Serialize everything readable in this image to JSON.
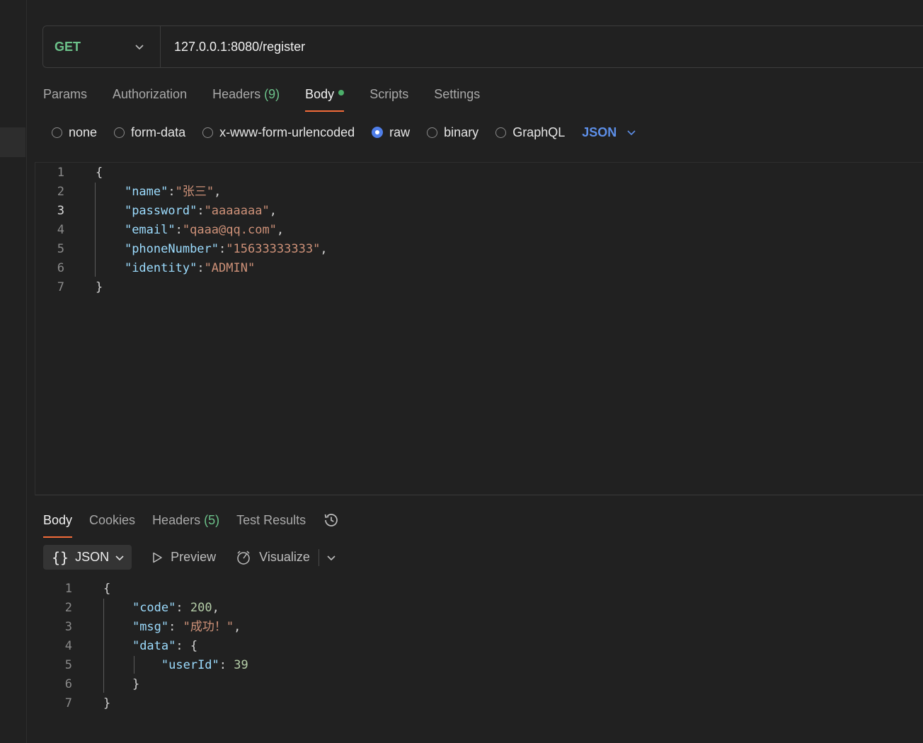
{
  "request": {
    "method": "GET",
    "url": "127.0.0.1:8080/register",
    "tabs": [
      {
        "label": "Params"
      },
      {
        "label": "Authorization"
      },
      {
        "label": "Headers",
        "count": "(9)"
      },
      {
        "label": "Body"
      },
      {
        "label": "Scripts"
      },
      {
        "label": "Settings"
      }
    ],
    "body_types": [
      "none",
      "form-data",
      "x-www-form-urlencoded",
      "raw",
      "binary",
      "GraphQL"
    ],
    "selected_body_type": "raw",
    "language": "JSON",
    "body_lines": [
      {
        "n": "1",
        "tokens": [
          [
            "p",
            "{"
          ]
        ]
      },
      {
        "n": "2",
        "tokens": [
          [
            "p",
            "    "
          ],
          [
            "k",
            "\"name\""
          ],
          [
            "p",
            ":"
          ],
          [
            "s",
            "\"张三\""
          ],
          [
            "p",
            ","
          ]
        ]
      },
      {
        "n": "3",
        "tokens": [
          [
            "p",
            "    "
          ],
          [
            "k",
            "\"password\""
          ],
          [
            "p",
            ":"
          ],
          [
            "s",
            "\"aaaaaaa\""
          ],
          [
            "p",
            ","
          ]
        ]
      },
      {
        "n": "4",
        "tokens": [
          [
            "p",
            "    "
          ],
          [
            "k",
            "\"email\""
          ],
          [
            "p",
            ":"
          ],
          [
            "s",
            "\"qaaa@qq.com\""
          ],
          [
            "p",
            ","
          ]
        ]
      },
      {
        "n": "5",
        "tokens": [
          [
            "p",
            "    "
          ],
          [
            "k",
            "\"phoneNumber\""
          ],
          [
            "p",
            ":"
          ],
          [
            "s",
            "\"15633333333\""
          ],
          [
            "p",
            ","
          ]
        ]
      },
      {
        "n": "6",
        "tokens": [
          [
            "p",
            "    "
          ],
          [
            "k",
            "\"identity\""
          ],
          [
            "p",
            ":"
          ],
          [
            "s",
            "\"ADMIN\""
          ]
        ]
      },
      {
        "n": "7",
        "tokens": [
          [
            "p",
            "}"
          ]
        ]
      }
    ]
  },
  "response": {
    "tabs": [
      {
        "label": "Body"
      },
      {
        "label": "Cookies"
      },
      {
        "label": "Headers",
        "count": "(5)"
      },
      {
        "label": "Test Results"
      }
    ],
    "format_label": "JSON",
    "preview_label": "Preview",
    "visualize_label": "Visualize",
    "body_lines": [
      {
        "n": "1",
        "tokens": [
          [
            "p",
            "{"
          ]
        ]
      },
      {
        "n": "2",
        "tokens": [
          [
            "p",
            "    "
          ],
          [
            "k",
            "\"code\""
          ],
          [
            "p",
            ": "
          ],
          [
            "n",
            "200"
          ],
          [
            "p",
            ","
          ]
        ]
      },
      {
        "n": "3",
        "tokens": [
          [
            "p",
            "    "
          ],
          [
            "k",
            "\"msg\""
          ],
          [
            "p",
            ": "
          ],
          [
            "s",
            "\"成功！\""
          ],
          [
            "p",
            ","
          ]
        ]
      },
      {
        "n": "4",
        "tokens": [
          [
            "p",
            "    "
          ],
          [
            "k",
            "\"data\""
          ],
          [
            "p",
            ": {"
          ]
        ]
      },
      {
        "n": "5",
        "tokens": [
          [
            "p",
            "        "
          ],
          [
            "k",
            "\"userId\""
          ],
          [
            "p",
            ": "
          ],
          [
            "n",
            "39"
          ]
        ]
      },
      {
        "n": "6",
        "tokens": [
          [
            "p",
            "    }"
          ]
        ]
      },
      {
        "n": "7",
        "tokens": [
          [
            "p",
            "}"
          ]
        ]
      }
    ]
  },
  "icons": [
    "chevron-down-icon",
    "history-icon",
    "braces-icon",
    "play-icon",
    "visualize-icon"
  ],
  "colors": {
    "accent_tab": "#f26b3a",
    "method_get": "#6cc28a",
    "radio_on": "#4f7ee8",
    "json_link": "#5d8fe8"
  }
}
